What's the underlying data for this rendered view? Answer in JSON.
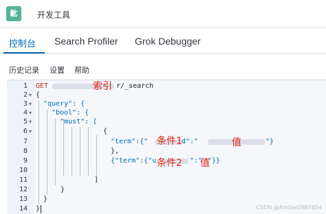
{
  "app": {
    "logo_text": "齔",
    "title": "开发工具"
  },
  "tabs": [
    {
      "label": "控制台",
      "active": true
    },
    {
      "label": "Search Profiler",
      "active": false
    },
    {
      "label": "Grok Debugger",
      "active": false
    }
  ],
  "menu": {
    "history": "历史记录",
    "settings": "设置",
    "help": "帮助"
  },
  "editor": {
    "lines": [
      {
        "num": "1",
        "fold": ""
      },
      {
        "num": "2",
        "fold": "▾"
      },
      {
        "num": "3",
        "fold": "▾"
      },
      {
        "num": "4",
        "fold": "▾"
      },
      {
        "num": "5",
        "fold": "▾"
      },
      {
        "num": "6",
        "fold": "▾"
      },
      {
        "num": "7",
        "fold": ""
      },
      {
        "num": "8",
        "fold": ""
      },
      {
        "num": "9",
        "fold": ""
      },
      {
        "num": "10",
        "fold": ""
      },
      {
        "num": "11",
        "fold": ""
      },
      {
        "num": "12",
        "fold": ""
      },
      {
        "num": "13",
        "fold": ""
      },
      {
        "num": "14",
        "fold": ""
      }
    ],
    "code": {
      "l1_method": "GET",
      "l1_path": "r/_search",
      "l2": "{",
      "l3": "\"query\": {",
      "l4": "\"bool\": {",
      "l5": "\"must\": [",
      "l6": "{",
      "l7_a": "\"term\":{\"",
      "l7_b": "d\":\"",
      "l7_c": "\"}",
      "l8": "},",
      "l9_a": "{\"term\":{\"u",
      "l9_b": "\":\"",
      "l9_c": "\"}}",
      "l10": "]",
      "l11": "}",
      "l12": "}",
      "l13": "}"
    }
  },
  "annotations": {
    "index": "索引",
    "cond1": "条件1",
    "val1": "值",
    "cond2": "条件2",
    "val2": "值"
  },
  "watermark": "CSDN @Amber0987654",
  "colors": {
    "accent": "#006bb4",
    "annotation": "#e3241b",
    "get_method": "#bd271e"
  }
}
